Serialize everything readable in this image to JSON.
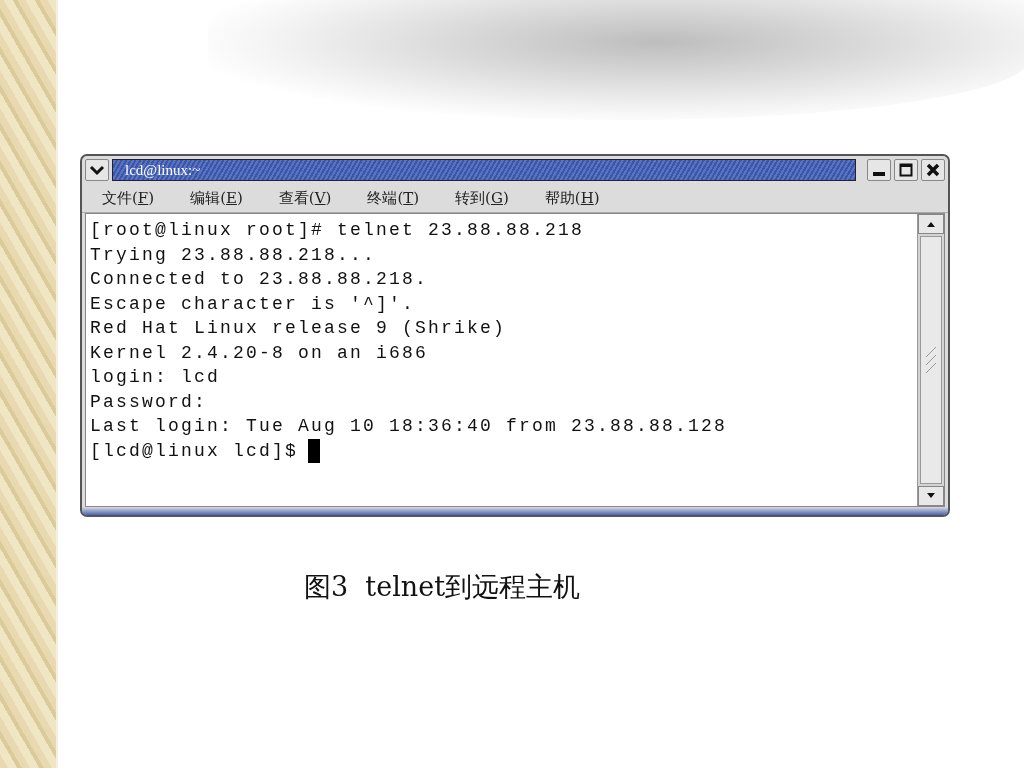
{
  "window": {
    "title": "lcd@linux:~"
  },
  "menu": [
    {
      "label": "文件(F)"
    },
    {
      "label": "编辑(E)"
    },
    {
      "label": "查看(V)"
    },
    {
      "label": "终端(T)"
    },
    {
      "label": "转到(G)"
    },
    {
      "label": "帮助(H)"
    }
  ],
  "terminal": {
    "lines": [
      "[root@linux root]# telnet 23.88.88.218",
      "Trying 23.88.88.218...",
      "Connected to 23.88.88.218.",
      "Escape character is '^]'.",
      "Red Hat Linux release 9 (Shrike)",
      "Kernel 2.4.20-8 on an i686",
      "login: lcd",
      "Password:",
      "Last login: Tue Aug 10 18:36:40 from 23.88.88.128"
    ],
    "prompt": "[lcd@linux lcd]$"
  },
  "caption": "图3  telnet到远程主机"
}
